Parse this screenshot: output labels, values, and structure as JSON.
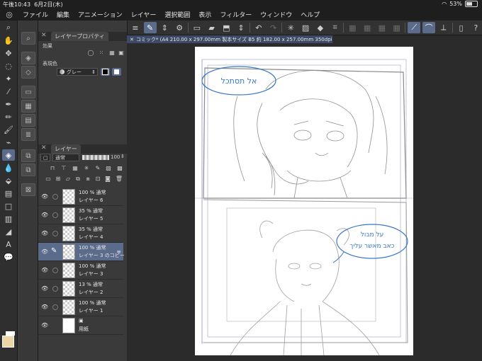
{
  "status": {
    "time": "午後10:43",
    "date": "6月2日(木)",
    "battery": "53%",
    "wifi_icon": "wifi-icon"
  },
  "menu": [
    "ファイル",
    "編集",
    "アニメーション",
    "レイヤー",
    "選択範囲",
    "表示",
    "フィルター",
    "ウィンドウ",
    "ヘルプ"
  ],
  "document": {
    "tab_label": "コミック* (A4 210.00 x 297.00mm 製本サイズ B5 約 182.00 x 257.00mm 350dpi 33.9%)"
  },
  "layer_property_panel": {
    "title": "レイヤープロパティ",
    "effect_label": "効果",
    "expression_color_label": "表現色",
    "expression_color_value": "グレー"
  },
  "layer_panel": {
    "title": "レイヤー",
    "blend_mode": "通常",
    "opacity": "100",
    "layers": [
      {
        "l1": "100 % 通常",
        "l2": "レイヤー 6",
        "active": false,
        "paper": false
      },
      {
        "l1": "35 % 通常",
        "l2": "レイヤー 5",
        "active": false,
        "paper": false
      },
      {
        "l1": "35 % 通常",
        "l2": "レイヤー 4",
        "active": false,
        "paper": false
      },
      {
        "l1": "100 % 通常",
        "l2": "レイヤー 3 のコピー",
        "active": true,
        "paper": false
      },
      {
        "l1": "100 % 通常",
        "l2": "レイヤー 3",
        "active": false,
        "paper": false
      },
      {
        "l1": "13 % 通常",
        "l2": "レイヤー 2",
        "active": false,
        "paper": false
      },
      {
        "l1": "100 % 通常",
        "l2": "レイヤー 1",
        "active": false,
        "paper": false
      },
      {
        "l1": "",
        "l2": "用紙",
        "active": false,
        "paper": true
      }
    ]
  },
  "canvas_text": {
    "bubble1": "אל תסתכל",
    "bubble2a": "על מבול",
    "bubble2b": "כאב מאשר עליך"
  },
  "colors": {
    "accent": "#5b6b8c",
    "sketch": "#9a9a9a",
    "note": "#3a78c8",
    "main_color": "#ecd6a6"
  }
}
